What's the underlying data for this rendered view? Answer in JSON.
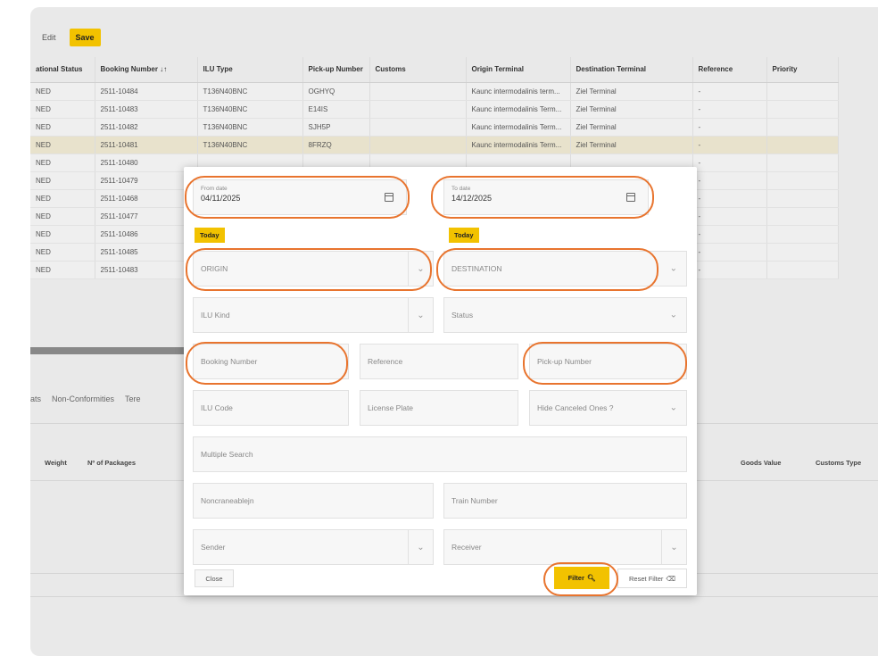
{
  "toolbar": {
    "edit_label": "Edit",
    "save_label": "Save"
  },
  "grid": {
    "columns": [
      "ational Status",
      "Booking Number ↓↑",
      "ILU Type",
      "Pick-up Number",
      "Customs",
      "Origin Terminal",
      "Destination Terminal",
      "Reference",
      "Priority"
    ],
    "rows": [
      [
        "NED",
        "2511-10484",
        "T136N40BNC",
        "OGHYQ",
        "",
        "Kaunc intermodalinis term...",
        "Ziel Terminal",
        "-",
        ""
      ],
      [
        "NED",
        "2511-10483",
        "T136N40BNC",
        "E14IS",
        "",
        "Kaunc intermodalinis Term...",
        "Ziel Terminal",
        "-",
        ""
      ],
      [
        "NED",
        "2511-10482",
        "T136N40BNC",
        "SJH5P",
        "",
        "Kaunc intermodalinis Term...",
        "Ziel Terminal",
        "-",
        ""
      ],
      [
        "NED",
        "2511-10481",
        "T136N40BNC",
        "8FRZQ",
        "",
        "Kaunc intermodalinis Term...",
        "Ziel Terminal",
        "-",
        ""
      ],
      [
        "NED",
        "2511-10480",
        "",
        "",
        "",
        "",
        "",
        "-",
        ""
      ],
      [
        "NED",
        "2511-10479",
        "",
        "",
        "",
        "",
        "",
        "-",
        ""
      ],
      [
        "NED",
        "2511-10468",
        "",
        "",
        "",
        "",
        "",
        "-",
        ""
      ],
      [
        "NED",
        "2511-10477",
        "",
        "",
        "",
        "",
        "",
        "-",
        ""
      ],
      [
        "NED",
        "2511-10486",
        "",
        "",
        "",
        "",
        "",
        "-",
        ""
      ],
      [
        "NED",
        "2511-10485",
        "",
        "",
        "",
        "",
        "",
        "-",
        ""
      ],
      [
        "NED",
        "2511-10483",
        "",
        "",
        "",
        "",
        "",
        "-",
        ""
      ]
    ]
  },
  "tabs": [
    "ats",
    "Non-Conformities",
    "Tere"
  ],
  "lower_columns": {
    "weight": "Weight",
    "packages": "Nº of Packages",
    "goods_value": "Goods Value",
    "customs_type": "Customs Type"
  },
  "filter": {
    "from_date": {
      "label": "From date",
      "value": "04/11/2025"
    },
    "to_date": {
      "label": "To date",
      "value": "14/12/2025"
    },
    "today_label": "Today",
    "origin": "ORIGIN",
    "destination": "DESTINATION",
    "ilu_kind": "ILU Kind",
    "status": "Status",
    "booking_number": "Booking Number",
    "reference": "Reference",
    "pickup_number": "Pick-up Number",
    "ilu_code": "ILU Code",
    "license_plate": "License Plate",
    "hide_canceled": "Hide Canceled Ones ?",
    "multiple_search": "Multiple Search",
    "noncranes": "Noncraneablejn",
    "train_number": "Train Number",
    "sender": "Sender",
    "receiver": "Receiver",
    "close_label": "Close",
    "filter_label": "Filter",
    "reset_label": "Reset Filter"
  },
  "colors": {
    "accent": "#f2c200",
    "highlight_ring": "#e8742e"
  }
}
